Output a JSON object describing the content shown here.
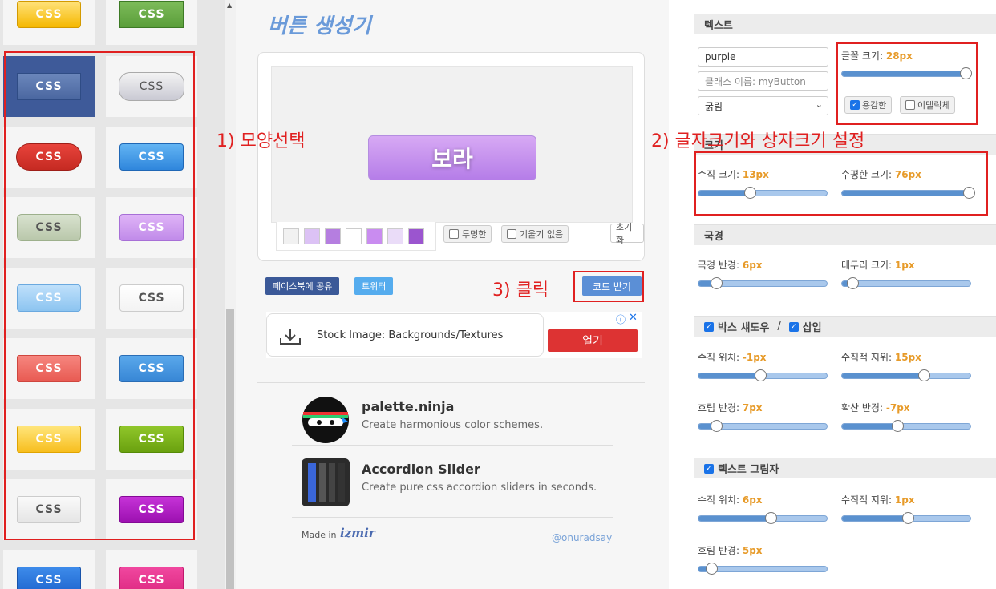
{
  "gallery": {
    "tiles": [
      {
        "label": "CSS",
        "bg": "linear-gradient(#ffe27a,#f5b800)",
        "border": "#d39a00",
        "radius": "4px",
        "light": false
      },
      {
        "label": "CSS",
        "bg": "linear-gradient(#7dbb5a,#5a9e3a)",
        "border": "#3d7a25",
        "radius": "0px",
        "light": false
      },
      {
        "label": "CSS",
        "bg": "linear-gradient(#6b86bb,#4a67a0)",
        "border": "#2f4c85",
        "radius": "0px",
        "light": false
      },
      {
        "label": "CSS",
        "bg": "linear-gradient(#f3f3f3,#c9c9d3)",
        "border": "#aaa",
        "radius": "14px",
        "light": true
      },
      {
        "label": "CSS",
        "bg": "linear-gradient(#e8433b,#c52a22)",
        "border": "#9e1e18",
        "radius": "18px",
        "light": false
      },
      {
        "label": "CSS",
        "bg": "linear-gradient(#62b4f3,#2f86dc)",
        "border": "#1f67b5",
        "radius": "4px",
        "light": false
      },
      {
        "label": "CSS",
        "bg": "linear-gradient(#d8e2cf,#b9c7aa)",
        "border": "#9db08c",
        "radius": "6px",
        "light": true
      },
      {
        "label": "CSS",
        "bg": "linear-gradient(#dfb4f7,#c08ae9)",
        "border": "#a76fd6",
        "radius": "4px",
        "light": false
      },
      {
        "label": "CSS",
        "bg": "linear-gradient(#bfe0fb,#8cc4f0)",
        "border": "#6ba9df",
        "radius": "4px",
        "light": false
      },
      {
        "label": "CSS",
        "bg": "linear-gradient(#ffffff,#f3f3f3)",
        "border": "#ccc",
        "radius": "4px",
        "light": true
      },
      {
        "label": "CSS",
        "bg": "linear-gradient(#f6867f,#e85a52)",
        "border": "#cf463e",
        "radius": "3px",
        "light": false
      },
      {
        "label": "CSS",
        "bg": "linear-gradient(#5aa8eb,#3786d5)",
        "border": "#2a6db5",
        "radius": "3px",
        "light": false
      },
      {
        "label": "CSS",
        "bg": "linear-gradient(#ffe57a,#f7be1e)",
        "border": "#e0a400",
        "radius": "3px",
        "light": false
      },
      {
        "label": "CSS",
        "bg": "linear-gradient(#90c62a,#6aa10f)",
        "border": "#558a07",
        "radius": "3px",
        "light": false
      },
      {
        "label": "CSS",
        "bg": "linear-gradient(#fafafa,#e5e5e5)",
        "border": "#ccc",
        "radius": "3px",
        "light": true
      },
      {
        "label": "CSS",
        "bg": "linear-gradient(#c633d8,#9c10b0)",
        "border": "#840a95",
        "radius": "3px",
        "light": false
      },
      {
        "label": "CSS",
        "bg": "linear-gradient(#3d8bea,#1f66cf)",
        "border": "#1853aa",
        "radius": "3px",
        "light": false
      },
      {
        "label": "CSS",
        "bg": "linear-gradient(#f0479f,#de2a82)",
        "border": "#c0186c",
        "radius": "3px",
        "light": false
      }
    ]
  },
  "center": {
    "title": "버튼 생성기",
    "preview_label": "보라",
    "swatches": [
      "#f1f1f1",
      "#dcc2f5",
      "#b57ee0",
      "#ffffff",
      "#c98cf0",
      "#eadcf8",
      "#9b55cf"
    ],
    "transparent_label": "투명한",
    "no_gradient_label": "기울기 없음",
    "reset_label": "초기화",
    "share_facebook": "페이스북에 공유",
    "share_twitter": "트위터",
    "get_code_label": "코드 받기",
    "ad": {
      "text": "Stock Image: Backgrounds/Textures",
      "open_label": "열기"
    },
    "promos": [
      {
        "name": "palette.ninja",
        "desc": "Create harmonious color schemes."
      },
      {
        "name": "Accordion Slider",
        "desc": "Create pure css accordion sliders in seconds."
      }
    ],
    "made_in": "Made in",
    "made_logo": "izmir",
    "handle": "@onuradsay"
  },
  "right": {
    "text_section": "텍스트",
    "text_value": "purple",
    "class_placeholder": "클래스 이름: myButton",
    "font_weight": "굵림",
    "font_size_label": "글꼴 크기:",
    "font_size_value": "28px",
    "font_size_pct": 0.96,
    "bold_label": "용감한",
    "italic_label": "이탤릭체",
    "size_section": "크기",
    "vertical_size_label": "수직 크기:",
    "vertical_size_value": "13px",
    "vertical_size_pct": 0.4,
    "horizontal_size_label": "수평한 크기:",
    "horizontal_size_value": "76px",
    "horizontal_size_pct": 0.99,
    "border_section": "국경",
    "border_radius_label": "국경 반경:",
    "border_radius_value": "6px",
    "border_radius_pct": 0.14,
    "border_width_label": "테두리 크기:",
    "border_width_value": "1px",
    "border_width_pct": 0.08,
    "shadow_section": "박스 섀도우",
    "shadow_sep": "/",
    "inset_label": "삽입",
    "shadow_vpos_label": "수직 위치:",
    "shadow_vpos_value": "-1px",
    "shadow_vpos_pct": 0.48,
    "shadow_vdist_label": "수직적 지위:",
    "shadow_vdist_value": "15px",
    "shadow_vdist_pct": 0.64,
    "shadow_blur_label": "흐림 반경:",
    "shadow_blur_value": "7px",
    "shadow_blur_pct": 0.14,
    "shadow_spread_label": "확산 반경:",
    "shadow_spread_value": "-7px",
    "shadow_spread_pct": 0.43,
    "text_shadow_section": "텍스트 그림자",
    "ts_vpos_label": "수직 위치:",
    "ts_vpos_value": "6px",
    "ts_vpos_pct": 0.56,
    "ts_vdist_label": "수직적 지위:",
    "ts_vdist_value": "1px",
    "ts_vdist_pct": 0.51,
    "ts_blur_label": "흐림 반경:",
    "ts_blur_value": "5px",
    "ts_blur_pct": 0.1
  },
  "annotations": {
    "step1": "1) 모양선택",
    "step2": "2) 글자크기와 상자크기 설정",
    "step3": "3) 클릭"
  },
  "colors": {
    "annotation_red": "#e02020",
    "accent_orange": "#e79b2a",
    "title_blue": "#6a9ad9"
  }
}
